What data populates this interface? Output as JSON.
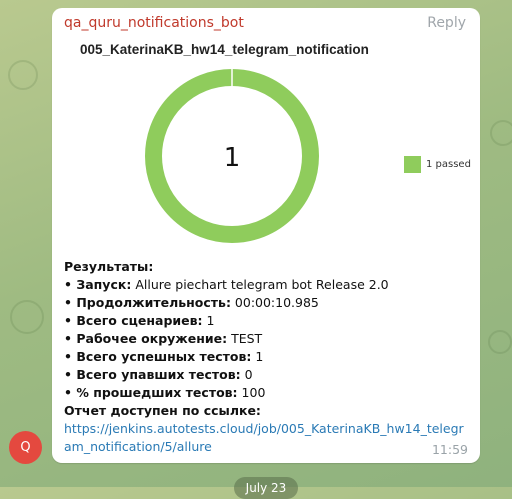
{
  "message": {
    "sender": "qa_quru_notifications_bot",
    "reply_label": "Reply",
    "time": "11:59",
    "avatar_letter": "Q",
    "lines": [
      {
        "label": "Результаты:",
        "value": ""
      },
      {
        "label": "• Запуск:",
        "value": " Allure piechart telegram bot Release 2.0"
      },
      {
        "label": "• Продолжительность:",
        "value": " 00:00:10.985"
      },
      {
        "label": "• Всего сценариев:",
        "value": " 1"
      },
      {
        "label": "• Рабочее окружение:",
        "value": " TEST"
      },
      {
        "label": "• Всего успешных тестов:",
        "value": " 1"
      },
      {
        "label": "• Всего упавших тестов:",
        "value": " 0"
      },
      {
        "label": "• % прошедших тестов:",
        "value": " 100"
      },
      {
        "label": "Отчет доступен по ссылке:",
        "value": ""
      }
    ],
    "link": "https://jenkins.autotests.cloud/job/005_KaterinaKB_hw14_telegram_notification/5/allure"
  },
  "chart_data": {
    "type": "pie",
    "title": "005_KaterinaKB_hw14_telegram_notification",
    "center_label": "1",
    "slices": [
      {
        "label": "passed",
        "value": 1,
        "color": "#8fcc5c"
      }
    ],
    "legend": [
      {
        "text": "1 passed",
        "color": "#8fcc5c"
      }
    ],
    "legend_position": "right"
  },
  "date_pill": "July 23"
}
